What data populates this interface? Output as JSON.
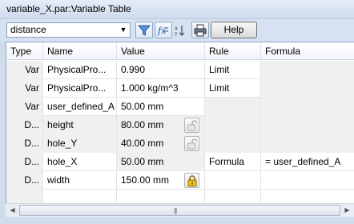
{
  "window": {
    "title": "variable_X.par:Variable Table"
  },
  "toolbar": {
    "filter_value": "distance",
    "filter_icon": "funnel-icon",
    "fx_icon": "formula-fx-icon",
    "sort_icon": "sort-az-icon",
    "print_icon": "printer-icon",
    "help_label": "Help"
  },
  "table": {
    "columns": [
      "Type",
      "Name",
      "Value",
      "Rule",
      "Formula"
    ],
    "rows": [
      {
        "type": "Var",
        "name": "PhysicalPro...",
        "value": "0.990",
        "rule": "Limit",
        "formula": "",
        "lock": ""
      },
      {
        "type": "Var",
        "name": "PhysicalPro...",
        "value": "1.000 kg/m^3",
        "rule": "Limit",
        "formula": "",
        "lock": ""
      },
      {
        "type": "Var",
        "name": "user_defined_A",
        "value": "50.00 mm",
        "rule": "",
        "formula": "",
        "lock": ""
      },
      {
        "type": "D...",
        "name": "height",
        "value": "80.00 mm",
        "rule": "",
        "formula": "",
        "lock": "unlocked"
      },
      {
        "type": "D...",
        "name": "hole_Y",
        "value": "40.00 mm",
        "rule": "",
        "formula": "",
        "lock": "unlocked"
      },
      {
        "type": "D...",
        "name": "hole_X",
        "value": "50.00 mm",
        "rule": "Formula",
        "formula": "= user_defined_A",
        "lock": ""
      },
      {
        "type": "D...",
        "name": "width",
        "value": "150.00 mm",
        "rule": "",
        "formula": "",
        "lock": "locked"
      }
    ]
  }
}
